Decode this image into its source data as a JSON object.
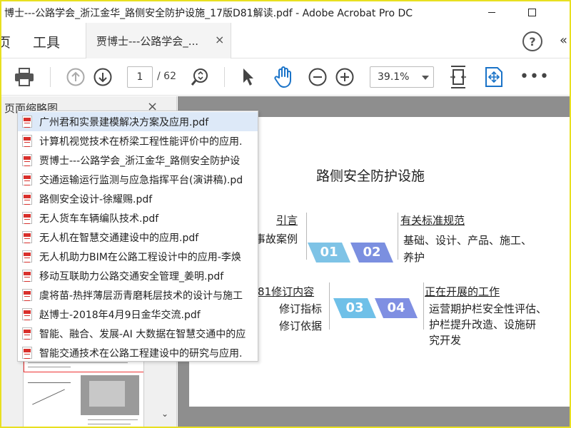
{
  "window": {
    "title": "博士---公路学会_浙江金华_路侧安全防护设施_17版D81解读.pdf - Adobe Acrobat Pro DC"
  },
  "menubar": {
    "home_label": "页",
    "tools_label": "工具",
    "doc_tab_label": "贾博士---公路学会_...",
    "doc_tab_close": "×",
    "help_label": "?",
    "right_cut": "«"
  },
  "toolbar": {
    "page_current": "1",
    "page_total": "/ 62",
    "zoom": "39.1%",
    "more": "•••"
  },
  "left_panel": {
    "title": "页面缩略图",
    "close": "×",
    "scroll_down": "⌄"
  },
  "file_list": [
    {
      "name": "广州君和实景建模解决方案及应用.pdf",
      "selected": true
    },
    {
      "name": "计算机视觉技术在桥梁工程性能评价中的应用.",
      "selected": false
    },
    {
      "name": "贾博士---公路学会_浙江金华_路侧安全防护设",
      "selected": false
    },
    {
      "name": "交通运输运行监测与应急指挥平台(演讲稿).pd",
      "selected": false
    },
    {
      "name": "路侧安全设计-徐耀赐.pdf",
      "selected": false
    },
    {
      "name": "无人货车车辆编队技术.pdf",
      "selected": false
    },
    {
      "name": "无人机在智慧交通建设中的应用.pdf",
      "selected": false
    },
    {
      "name": "无人机助力BIM在公路工程设计中的应用-李焕",
      "selected": false
    },
    {
      "name": "移动互联助力公路交通安全管理_姜明.pdf",
      "selected": false
    },
    {
      "name": "虞将苗-热拌薄层沥青磨耗层技术的设计与施工",
      "selected": false
    },
    {
      "name": "赵博士-2018年4月9日金华交流.pdf",
      "selected": false
    },
    {
      "name": "智能、融合、发展-AI 大数据在智慧交通中的应",
      "selected": false
    },
    {
      "name": "智能交通技术在公路工程建设中的研究与应用.",
      "selected": false
    }
  ],
  "page": {
    "title": "路侧安全防护设施",
    "s1_heading": "引言",
    "s1_line": "事故案例",
    "s2_heading": "有关标准规范",
    "s2_line1": "基础、设计、产品、施工、",
    "s2_line2": "养护",
    "s3_heading": "81修订内容",
    "s3_line1": "修订指标",
    "s3_line2": "修订依据",
    "s4_heading": "正在开展的工作",
    "s4_line1": "运营期护栏安全性评估、",
    "s4_line2": "护栏提升改造、设施研",
    "s4_line3": "究开发",
    "n1": "01",
    "n2": "02",
    "n3": "03",
    "n4": "04"
  },
  "colors": {
    "chevron_light": "#7ec3e6",
    "chevron_dark": "#7b8fe0",
    "chevron_light2": "#6fc0e8",
    "chevron_dark2": "#7f8fe2",
    "frame": "#e8e020",
    "pdf_red": "#d9302c"
  }
}
